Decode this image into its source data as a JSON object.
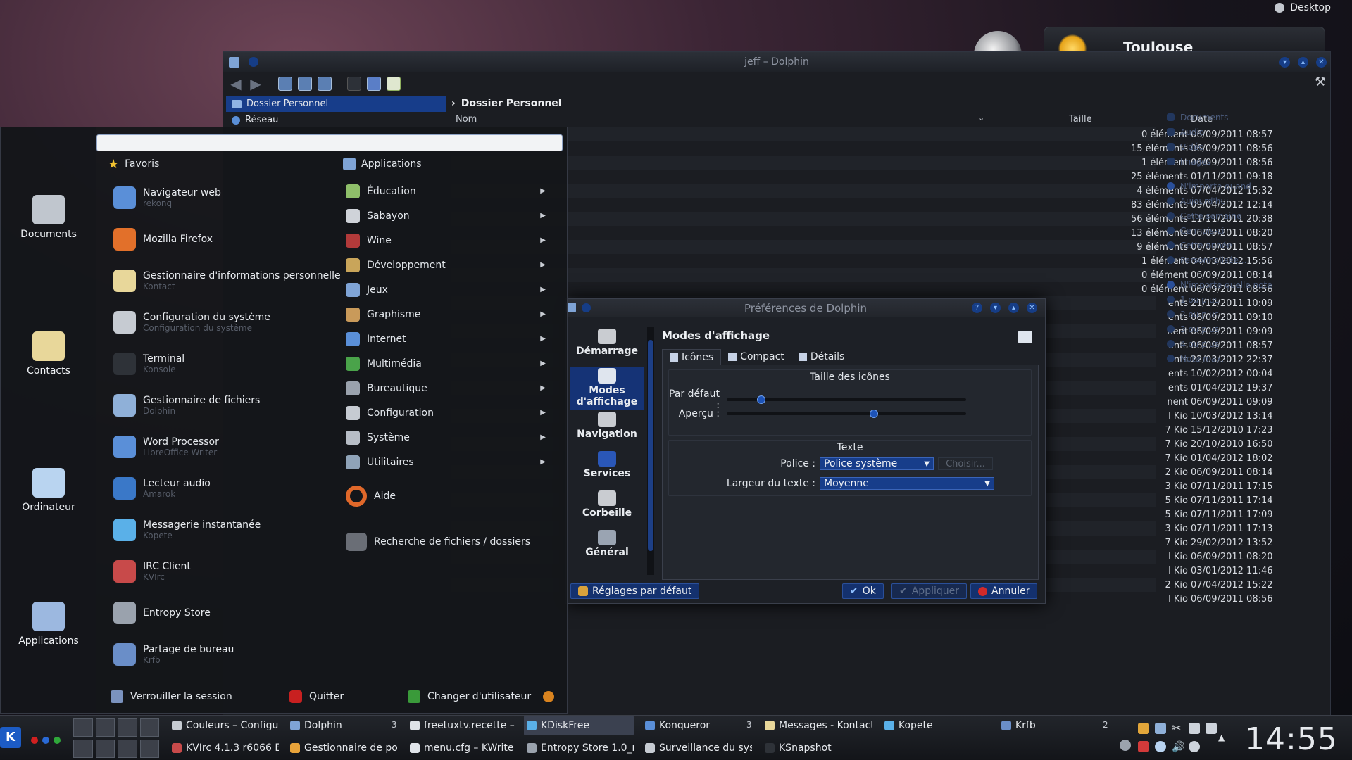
{
  "desktop": {
    "label": "Desktop"
  },
  "weather": {
    "city": "Toulouse"
  },
  "dolphin": {
    "title": "jeff – Dolphin",
    "places": [
      {
        "label": "Dossier Personnel",
        "selected": true
      },
      {
        "label": "Réseau",
        "selected": false
      }
    ],
    "breadcrumb": "Dossier Personnel",
    "columns": {
      "name": "Nom",
      "size": "Taille",
      "date": "Date"
    },
    "rows": [
      {
        "size": "0 élément",
        "date": "06/09/2011 08:57"
      },
      {
        "size": "15 éléments",
        "date": "06/09/2011 08:56"
      },
      {
        "size": "1 élément",
        "date": "06/09/2011 08:56"
      },
      {
        "size": "25 éléments",
        "date": "01/11/2011 09:18"
      },
      {
        "size": "4 éléments",
        "date": "07/04/2012 15:32"
      },
      {
        "size": "83 éléments",
        "date": "09/04/2012 12:14"
      },
      {
        "size": "56 éléments",
        "date": "11/11/2011 20:38"
      },
      {
        "size": "13 éléments",
        "date": "06/09/2011 08:20"
      },
      {
        "size": "9 éléments",
        "date": "06/09/2011 08:57"
      },
      {
        "size": "1 élément",
        "date": "04/03/2012 15:56"
      },
      {
        "size": "0 élément",
        "date": "06/09/2011 08:14"
      },
      {
        "size": "0 élément",
        "date": "06/09/2011 08:56"
      },
      {
        "size": "ents",
        "date": "21/12/2011 10:09"
      },
      {
        "size": "ents",
        "date": "06/09/2011 09:10"
      },
      {
        "size": "nent",
        "date": "06/09/2011 09:09"
      },
      {
        "size": "ents",
        "date": "06/09/2011 08:57"
      },
      {
        "size": "ents",
        "date": "22/03/2012 22:37"
      },
      {
        "size": "ents",
        "date": "10/02/2012 00:04"
      },
      {
        "size": "ents",
        "date": "01/04/2012 19:37"
      },
      {
        "size": "nent",
        "date": "06/09/2011 09:09"
      },
      {
        "size": "l Kio",
        "date": "10/03/2012 13:14"
      },
      {
        "size": "7 Kio",
        "date": "15/12/2010 17:23"
      },
      {
        "size": "7 Kio",
        "date": "20/10/2010 16:50"
      },
      {
        "size": "7 Kio",
        "date": "01/04/2012 18:02"
      },
      {
        "size": "2 Kio",
        "date": "06/09/2011 08:14"
      },
      {
        "size": "3 Kio",
        "date": "07/11/2011 17:15"
      },
      {
        "size": "5 Kio",
        "date": "07/11/2011 17:14"
      },
      {
        "size": "5 Kio",
        "date": "07/11/2011 17:09"
      },
      {
        "size": "3 Kio",
        "date": "07/11/2011 17:13"
      },
      {
        "size": "7 Kio",
        "date": "29/02/2012 13:52"
      },
      {
        "size": "l Kio",
        "date": "06/09/2011 08:20"
      },
      {
        "size": "l Kio",
        "date": "03/01/2012 11:46"
      },
      {
        "size": "2 Kio",
        "date": "07/04/2012 15:22"
      },
      {
        "size": "l Kio",
        "date": "06/09/2011 08:56"
      }
    ],
    "filter_panel": {
      "types": [
        "Documents",
        "Audio",
        "Vidéo",
        "Images"
      ],
      "dates": [
        "N'importe quand",
        "Aujourd'hui",
        "Cette semaine",
        "Ce mois-ci",
        "Cette année",
        "Personnalisée..."
      ],
      "ratings": [
        "N'importe quelle note",
        "1 ou plus",
        "2 ou plus",
        "3 ou plus",
        "4 ou plus",
        "Note max."
      ]
    }
  },
  "prefs": {
    "title": "Préférences de Dolphin",
    "categories": [
      {
        "label": "Démarrage",
        "selected": false
      },
      {
        "label": "Modes d'affichage",
        "selected": true
      },
      {
        "label": "Navigation",
        "selected": false
      },
      {
        "label": "Services",
        "selected": false
      },
      {
        "label": "Corbeille",
        "selected": false
      },
      {
        "label": "Général",
        "selected": false
      }
    ],
    "heading": "Modes d'affichage",
    "tabs": [
      {
        "label": "Icônes",
        "selected": true
      },
      {
        "label": "Compact",
        "selected": false
      },
      {
        "label": "Détails",
        "selected": false
      }
    ],
    "icon_size": {
      "title": "Taille des icônes",
      "default_label": "Par défaut :",
      "default_level": 0.13,
      "preview_label": "Aperçu :",
      "preview_level": 0.62
    },
    "text": {
      "title": "Texte",
      "font_label": "Police :",
      "font_value": "Police système",
      "choose_label": "Choisir...",
      "width_label": "Largeur du texte :",
      "width_value": "Moyenne"
    },
    "buttons": {
      "defaults": "Réglages par défaut",
      "ok": "Ok",
      "apply": "Appliquer",
      "cancel": "Annuler"
    }
  },
  "kickoff": {
    "sidebar": [
      {
        "label": "Documents",
        "icon": "typewriter-icon"
      },
      {
        "label": "Contacts",
        "icon": "contacts-icon"
      },
      {
        "label": "Ordinateur",
        "icon": "laptop-icon"
      },
      {
        "label": "Applications",
        "icon": "applications-icon"
      }
    ],
    "search_value": "",
    "favorites_title": "Favoris",
    "applications_title": "Applications",
    "favorites": [
      {
        "title": "Navigateur web",
        "subtitle": "rekonq",
        "icon": "globe-icon"
      },
      {
        "title": "Mozilla Firefox",
        "subtitle": "",
        "icon": "firefox-icon"
      },
      {
        "title": "Gestionnaire d'informations personnelle",
        "subtitle": "Kontact",
        "icon": "kontact-icon"
      },
      {
        "title": "Configuration du système",
        "subtitle": "Configuration du système",
        "icon": "tools-icon"
      },
      {
        "title": "Terminal",
        "subtitle": "Konsole",
        "icon": "terminal-icon"
      },
      {
        "title": "Gestionnaire de fichiers",
        "subtitle": "Dolphin",
        "icon": "file-manager-icon"
      },
      {
        "title": "Word Processor",
        "subtitle": "LibreOffice Writer",
        "icon": "word-processor-icon"
      },
      {
        "title": "Lecteur audio",
        "subtitle": "Amarok",
        "icon": "audio-player-icon"
      },
      {
        "title": "Messagerie instantanée",
        "subtitle": "Kopete",
        "icon": "chat-icon"
      },
      {
        "title": "IRC Client",
        "subtitle": "KVIrc",
        "icon": "irc-icon"
      },
      {
        "title": "Entropy Store",
        "subtitle": "",
        "icon": "store-icon"
      },
      {
        "title": "Partage de bureau",
        "subtitle": "Krfb",
        "icon": "desktop-sharing-icon"
      }
    ],
    "categories": [
      "Éducation",
      "Sabayon",
      "Wine",
      "Développement",
      "Jeux",
      "Graphisme",
      "Internet",
      "Multimédia",
      "Bureautique",
      "Configuration",
      "Système",
      "Utilitaires"
    ],
    "help_label": "Aide",
    "search_files_label": "Recherche de fichiers / dossiers",
    "bottom": {
      "lock": "Verrouiller la session",
      "quit": "Quitter",
      "switch_user": "Changer d'utilisateur"
    }
  },
  "taskbar": {
    "tasks_row1": [
      "Couleurs – Configura",
      "Dolphin",
      "freetuxtv.recette – K",
      "KDiskFree",
      "Konqueror",
      "Messages - Kontact",
      "Kopete",
      "Krfb"
    ],
    "tasks_row2": [
      "KVIrc 4.1.3 r6066 Eq",
      "Gestionnaire de port",
      "menu.cfg – KWrite",
      "Entropy Store 1.0_rc",
      "Surveillance du syst",
      "KSnapshot"
    ],
    "badge_dolphin": "3",
    "badge_konqueror": "3",
    "badge_krfb": "2",
    "clock": "14:55"
  }
}
